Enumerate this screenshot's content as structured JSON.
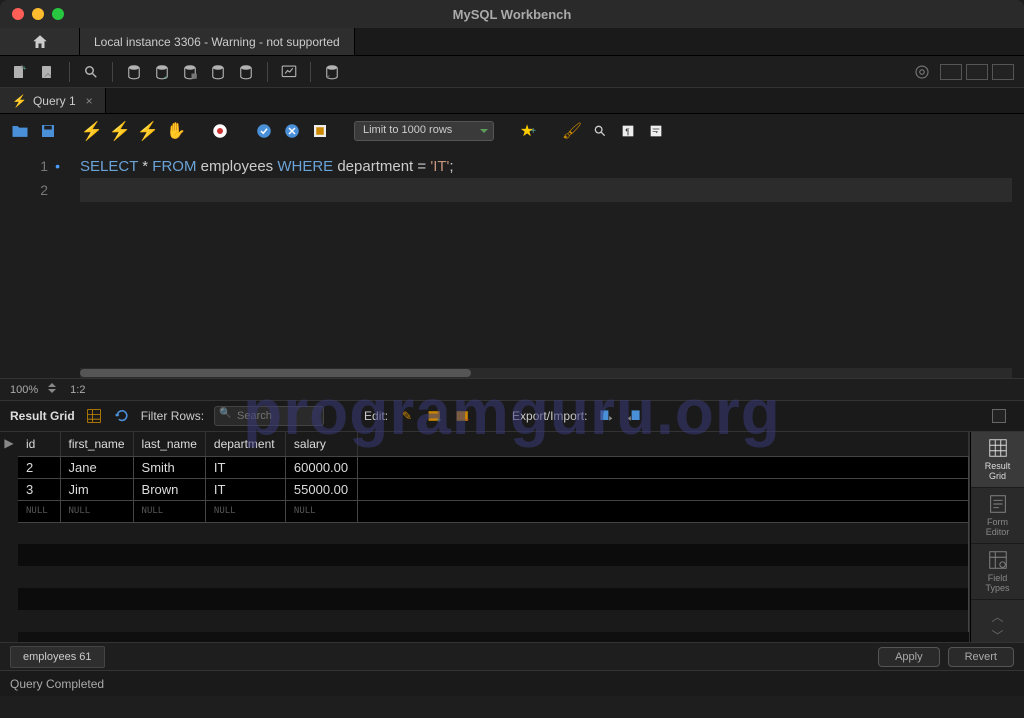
{
  "window": {
    "title": "MySQL Workbench"
  },
  "connection_tab": "Local instance 3306 - Warning - not supported",
  "query_tab": {
    "label": "Query 1"
  },
  "limit_dropdown": "Limit to 1000 rows",
  "editor": {
    "line1_tokens": [
      "SELECT",
      " * ",
      "FROM",
      " employees ",
      "WHERE",
      " department = ",
      "'IT'",
      ";"
    ],
    "line_numbers": [
      "1",
      "2"
    ]
  },
  "zoom": {
    "percent": "100%",
    "cursor_pos": "1:2"
  },
  "result_toolbar": {
    "label": "Result Grid",
    "filter_label": "Filter Rows:",
    "filter_placeholder": "Search",
    "edit_label": "Edit:",
    "export_label": "Export/Import:"
  },
  "side_tabs": {
    "grid": "Result\nGrid",
    "form": "Form\nEditor",
    "types": "Field\nTypes"
  },
  "columns": [
    "id",
    "first_name",
    "last_name",
    "department",
    "salary"
  ],
  "rows": [
    {
      "id": "2",
      "first_name": "Jane",
      "last_name": "Smith",
      "department": "IT",
      "salary": "60000.00"
    },
    {
      "id": "3",
      "first_name": "Jim",
      "last_name": "Brown",
      "department": "IT",
      "salary": "55000.00"
    }
  ],
  "null_label": "NULL",
  "bottom_tab": "employees 61",
  "buttons": {
    "apply": "Apply",
    "revert": "Revert"
  },
  "status": "Query Completed",
  "watermark": "programguru.org"
}
